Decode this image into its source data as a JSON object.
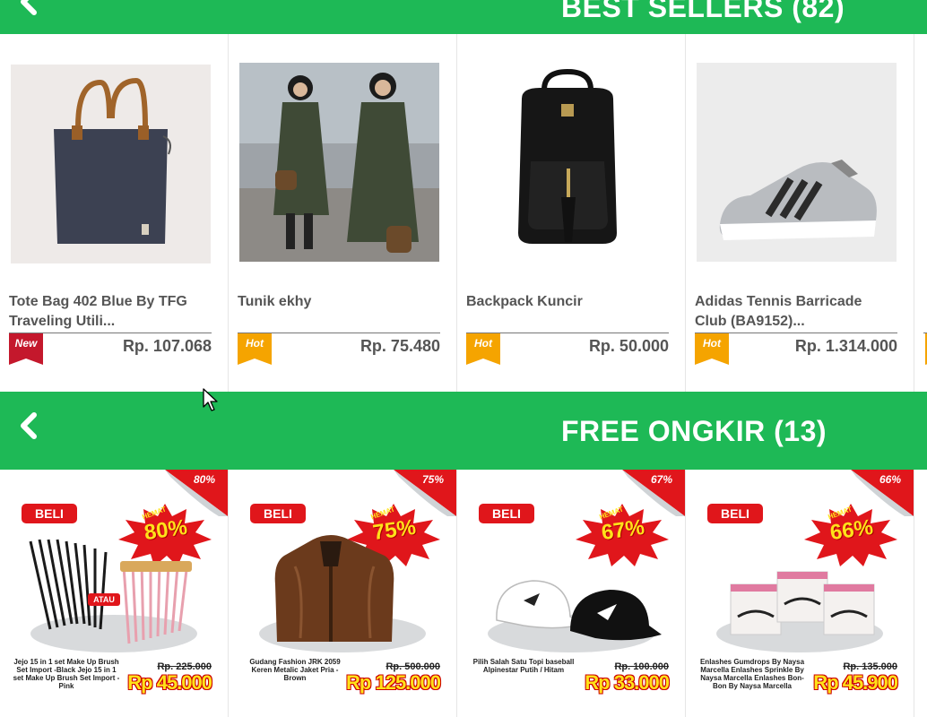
{
  "sections": {
    "best_sellers": {
      "title": "BEST SELLERS (82)"
    },
    "free_ongkir": {
      "title": "FREE ONGKIR (13)"
    }
  },
  "colors": {
    "header_green": "#1eb956",
    "badge_new": "#c4182c",
    "badge_hot": "#f5a400",
    "promo_red": "#e0161b"
  },
  "products": [
    {
      "name": "Tote Bag 402 Blue By TFG Traveling Utili...",
      "price": "Rp. 107.068",
      "badge": "New"
    },
    {
      "name": "Tunik ekhy",
      "price": "Rp. 75.480",
      "badge": "Hot"
    },
    {
      "name": "Backpack Kuncir",
      "price": "Rp. 50.000",
      "badge": "Hot"
    },
    {
      "name": "Adidas Tennis Barricade Club (BA9152)...",
      "price": "Rp. 1.314.000",
      "badge": "Hot"
    }
  ],
  "promos": [
    {
      "discount": "80%",
      "beli": "BELI",
      "hemat": "HEMAT",
      "hemat_pct": "80%",
      "desc": "Jejo 15 in 1 set Make Up Brush Set Import -Black   Jejo 15 in 1 set Make Up Brush Set Import -Pink",
      "old_price": "Rp. 225.000",
      "new_price": "Rp 45.000",
      "atau": "ATAU"
    },
    {
      "discount": "75%",
      "beli": "BELI",
      "hemat": "HEMAT",
      "hemat_pct": "75%",
      "desc": "Gudang Fashion JRK 2059 Keren Metalic Jaket Pria - Brown",
      "old_price": "Rp. 500.000",
      "new_price": "Rp 125.000"
    },
    {
      "discount": "67%",
      "beli": "BELI",
      "hemat": "HEMAT",
      "hemat_pct": "67%",
      "desc": "Pilih Salah Satu Topi baseball Alpinestar Putih / Hitam",
      "old_price": "Rp. 100.000",
      "new_price": "Rp 33.000"
    },
    {
      "discount": "66%",
      "beli": "BELI",
      "hemat": "HEMAT",
      "hemat_pct": "66%",
      "desc": "Enlashes Gumdrops By Naysa Marcella   Enlashes Sprinkle By Naysa Marcella   Enlashes Bon-Bon By Naysa Marcella",
      "old_price": "Rp. 135.000",
      "new_price": "Rp 45.900"
    }
  ]
}
